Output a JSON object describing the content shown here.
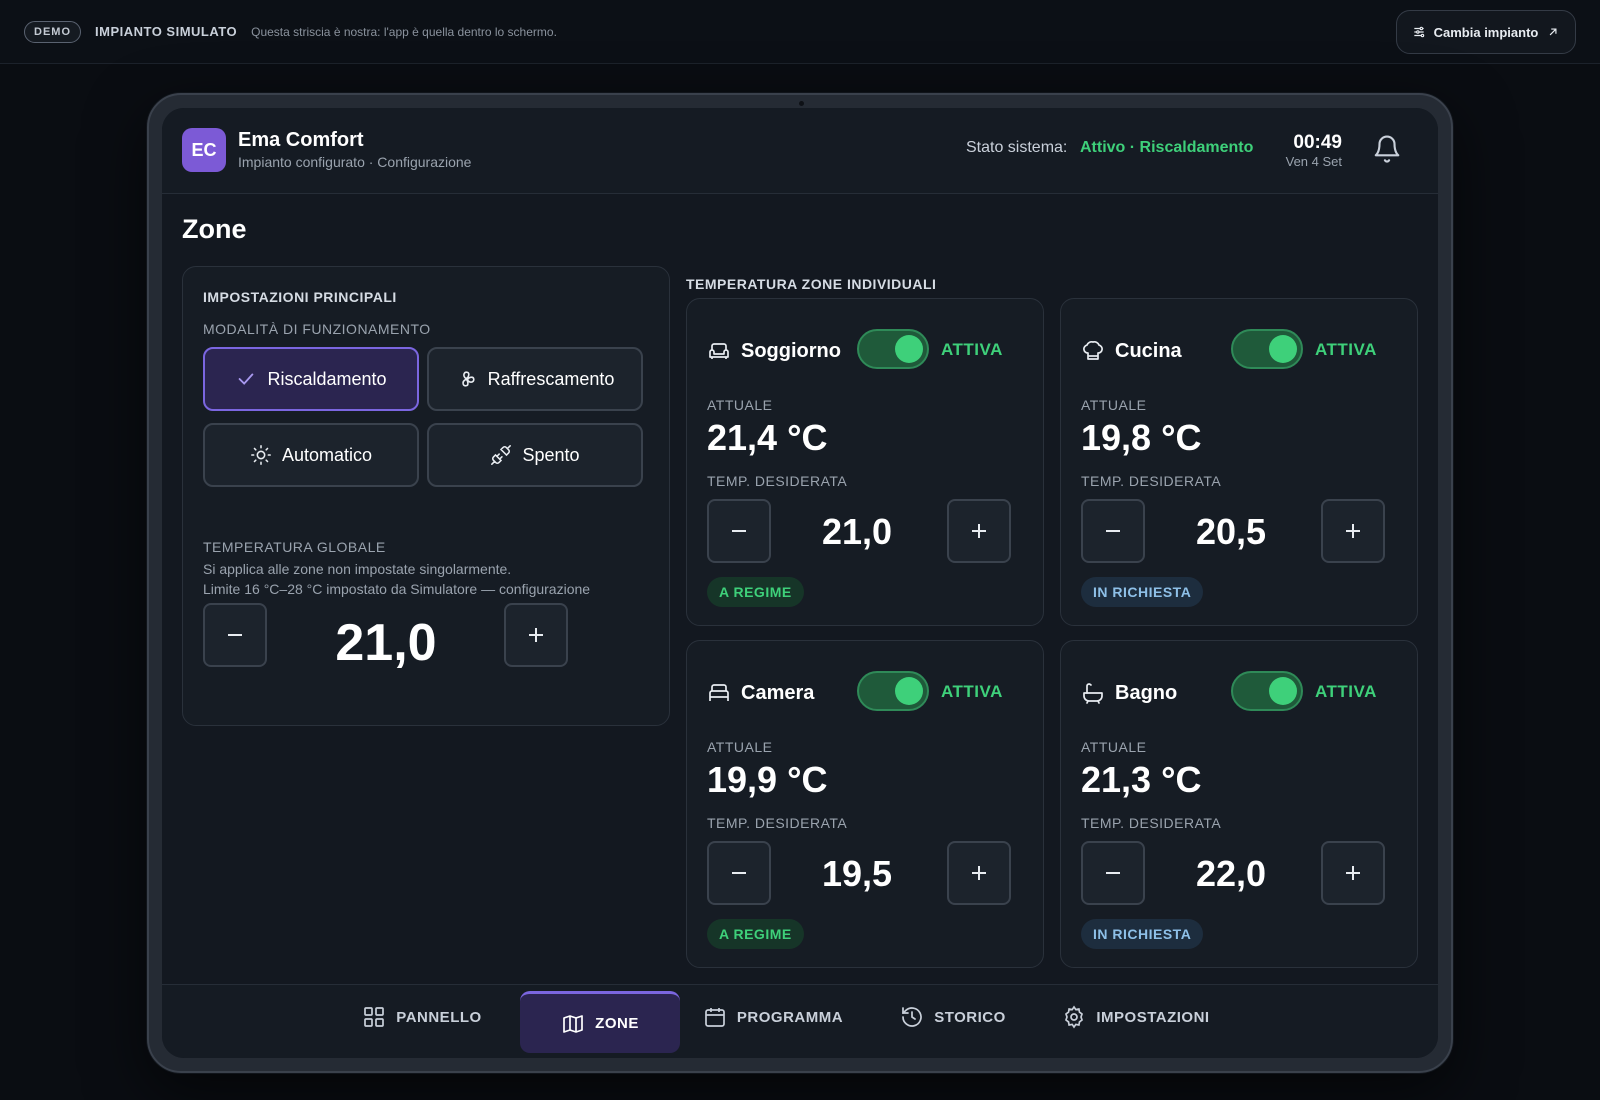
{
  "demo_strip": {
    "badge": "DEMO",
    "title": "IMPIANTO SIMULATO",
    "note": "Questa striscia è nostra: l'app è quella dentro lo schermo.",
    "change_button": "Cambia impianto"
  },
  "header": {
    "avatar": "EC",
    "app_name": "Ema Comfort",
    "subtitle": "Impianto configurato · Configurazione",
    "system_label": "Stato sistema:",
    "system_value": "Attivo · Riscaldamento",
    "time": "00:49",
    "date": "Ven 4 Set"
  },
  "page": {
    "title": "Zone"
  },
  "main_settings": {
    "title": "IMPOSTAZIONI PRINCIPALI",
    "mode_label": "MODALITÀ DI FUNZIONAMENTO",
    "modes": [
      {
        "label": "Riscaldamento",
        "icon": "check-icon",
        "active": true
      },
      {
        "label": "Raffrescamento",
        "icon": "fan-icon",
        "active": false
      },
      {
        "label": "Automatico",
        "icon": "sun-icon",
        "active": false
      },
      {
        "label": "Spento",
        "icon": "plug-off-icon",
        "active": false
      }
    ],
    "global_label": "TEMPERATURA GLOBALE",
    "global_note_1": "Si applica alle zone non impostate singolarmente.",
    "global_note_2": "Limite 16 °C–28 °C impostato da Simulatore — configurazione",
    "global_value": "21,0"
  },
  "zones_title": "TEMPERATURA ZONE INDIVIDUALI",
  "zones": [
    {
      "name": "Soggiorno",
      "icon": "sofa-icon",
      "toggle_label": "ATTIVA",
      "enabled": true,
      "current_label": "ATTUALE",
      "current": "21,4 °C",
      "desired_label": "TEMP. DESIDERATA",
      "desired": "21,0",
      "status": "A REGIME"
    },
    {
      "name": "Cucina",
      "icon": "chef-hat-icon",
      "toggle_label": "ATTIVA",
      "enabled": true,
      "current_label": "ATTUALE",
      "current": "19,8 °C",
      "desired_label": "TEMP. DESIDERATA",
      "desired": "20,5",
      "status": "IN RICHIESTA"
    },
    {
      "name": "Camera",
      "icon": "bed-icon",
      "toggle_label": "ATTIVA",
      "enabled": true,
      "current_label": "ATTUALE",
      "current": "19,9 °C",
      "desired_label": "TEMP. DESIDERATA",
      "desired": "19,5",
      "status": "A REGIME"
    },
    {
      "name": "Bagno",
      "icon": "bath-icon",
      "toggle_label": "ATTIVA",
      "enabled": true,
      "current_label": "ATTUALE",
      "current": "21,3 °C",
      "desired_label": "TEMP. DESIDERATA",
      "desired": "22,0",
      "status": "IN RICHIESTA"
    }
  ],
  "nav": [
    {
      "label": "PANNELLO",
      "icon": "grid-icon",
      "active": false
    },
    {
      "label": "ZONE",
      "icon": "map-icon",
      "active": true
    },
    {
      "label": "PROGRAMMA",
      "icon": "calendar-icon",
      "active": false
    },
    {
      "label": "STORICO",
      "icon": "history-icon",
      "active": false
    },
    {
      "label": "IMPOSTAZIONI",
      "icon": "gear-icon",
      "active": false
    }
  ],
  "colors": {
    "accent": "#7b66e0",
    "active_green": "#3ed07a",
    "background": "#0a0d12",
    "panel": "#161c24"
  }
}
